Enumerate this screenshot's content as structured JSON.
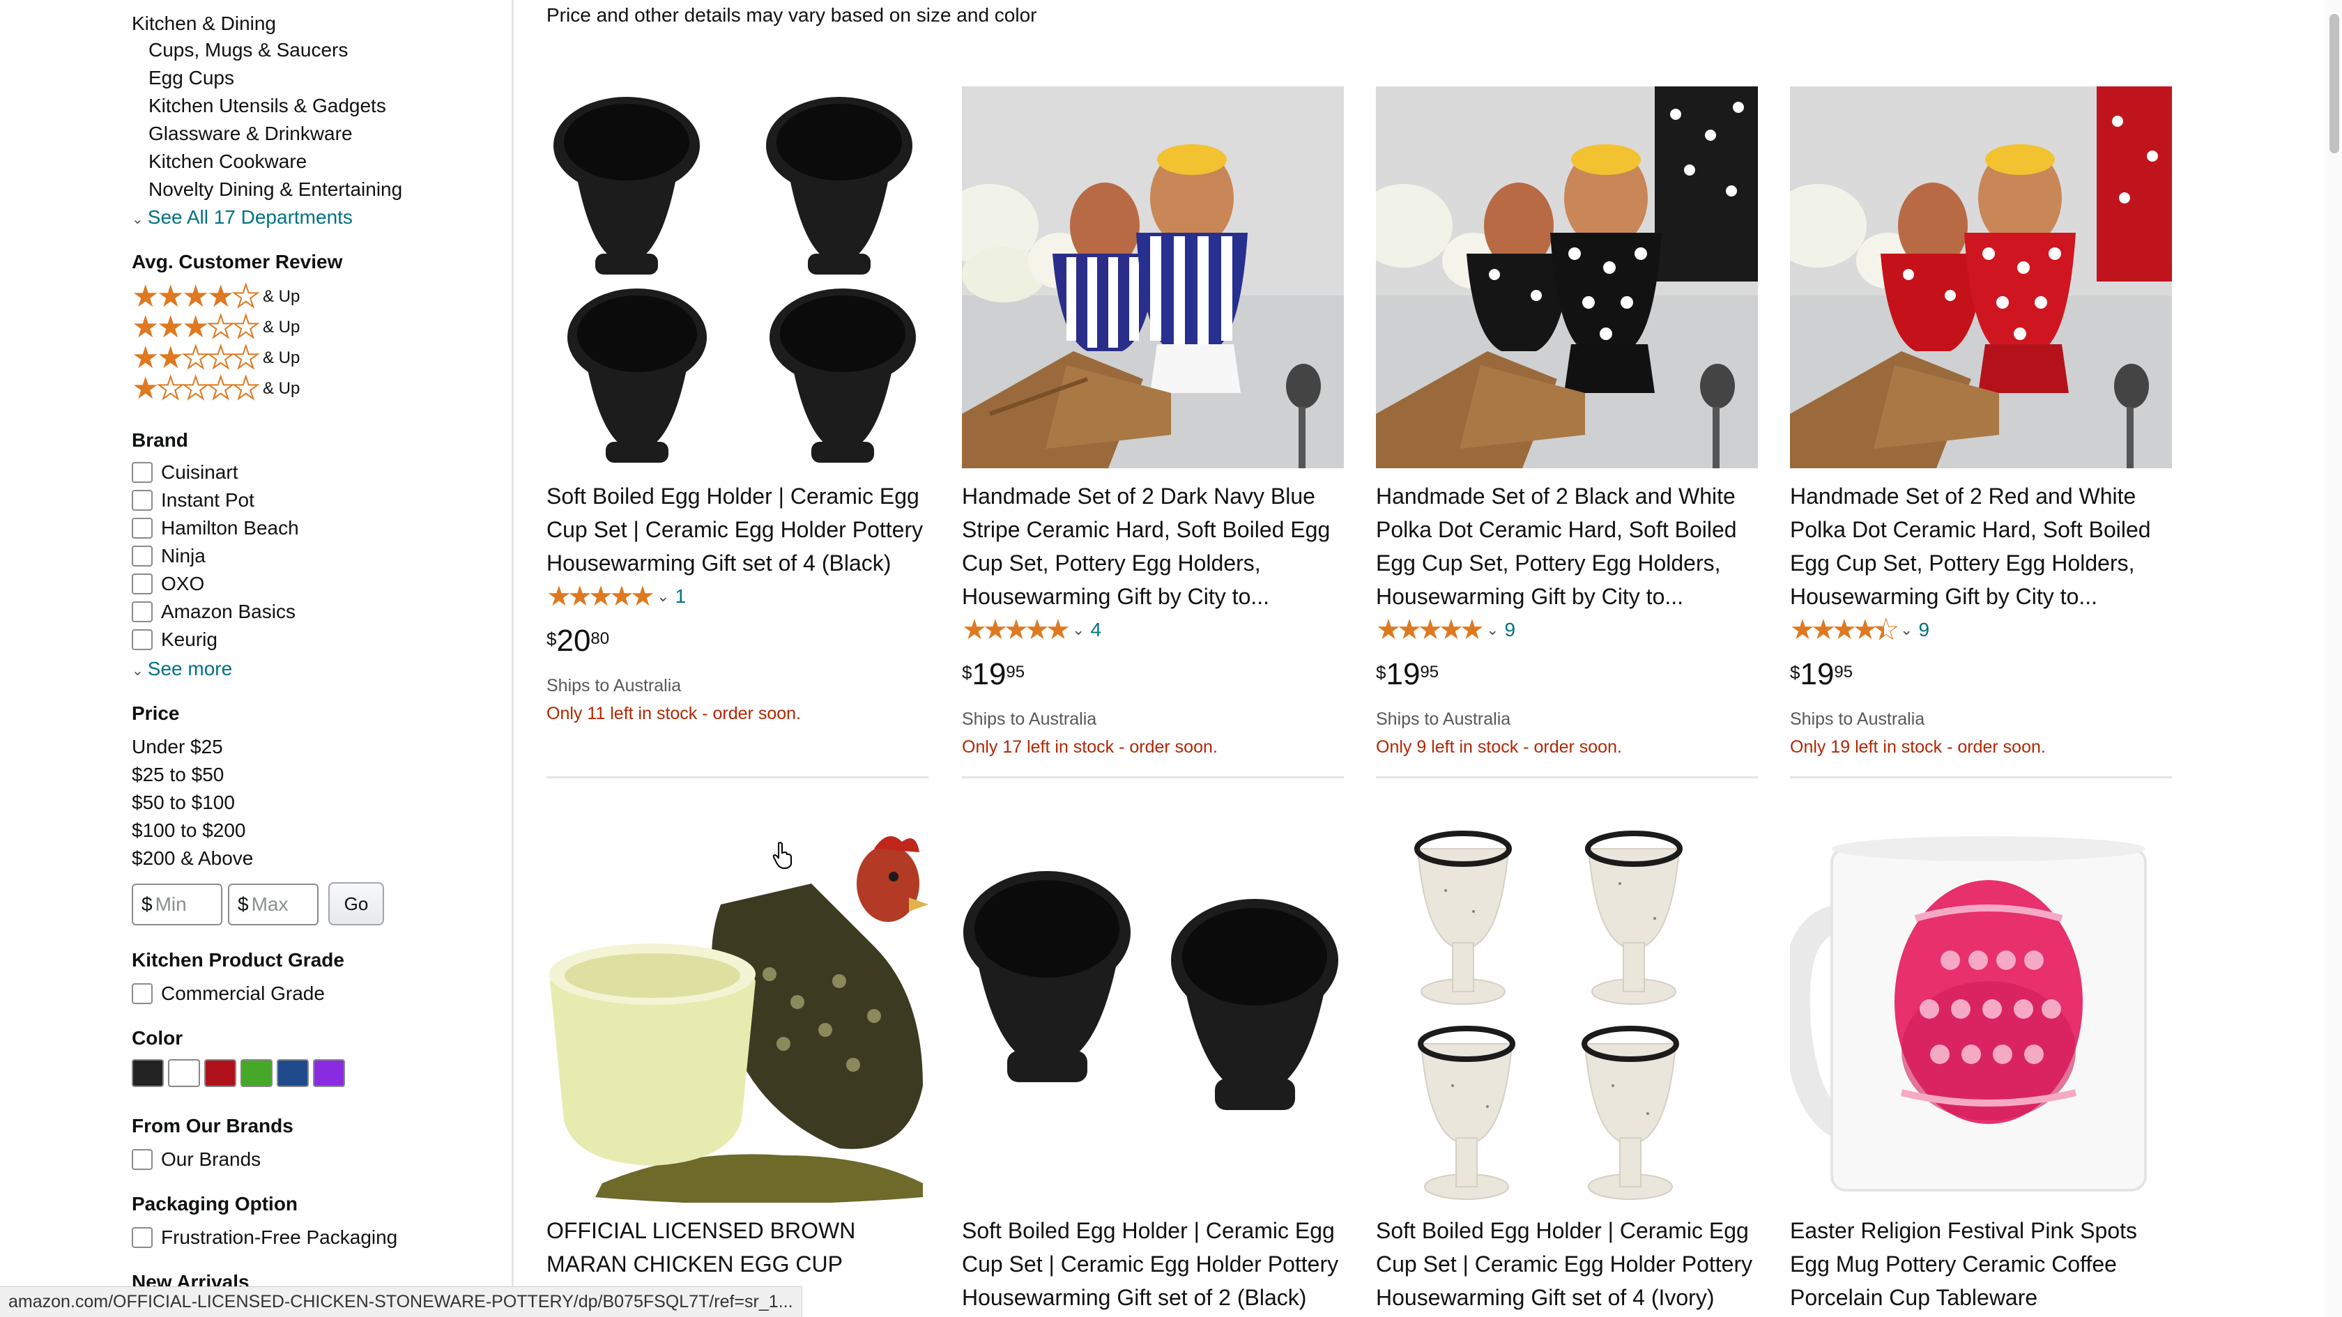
{
  "sidebar": {
    "department": "Kitchen & Dining",
    "subcategories": [
      "Cups, Mugs & Saucers",
      "Egg Cups",
      "Kitchen Utensils & Gadgets",
      "Glassware & Drinkware",
      "Kitchen Cookware",
      "Novelty Dining & Entertaining"
    ],
    "see_all": "See All 17 Departments",
    "review_heading": "Avg. Customer Review",
    "review_rows": [
      {
        "stars": 4,
        "label": "& Up"
      },
      {
        "stars": 3,
        "label": "& Up"
      },
      {
        "stars": 2,
        "label": "& Up"
      },
      {
        "stars": 1,
        "label": "& Up"
      }
    ],
    "brand_heading": "Brand",
    "brands": [
      "Cuisinart",
      "Instant Pot",
      "Hamilton Beach",
      "Ninja",
      "OXO",
      "Amazon Basics",
      "Keurig"
    ],
    "see_more": "See more",
    "price_heading": "Price",
    "price_ranges": [
      "Under $25",
      "$25 to $50",
      "$50 to $100",
      "$100 to $200",
      "$200 & Above"
    ],
    "min_symbol": "$",
    "min_placeholder": "Min",
    "max_symbol": "$",
    "max_placeholder": "Max",
    "go_label": "Go",
    "grade_heading": "Kitchen Product Grade",
    "grade_option": "Commercial Grade",
    "color_heading": "Color",
    "colors": [
      "#232323",
      "#ffffff",
      "#b0121b",
      "#46a829",
      "#1f4b8c",
      "#8a2be2"
    ],
    "our_brands_heading": "From Our Brands",
    "our_brands_option": "Our Brands",
    "packaging_heading": "Packaging Option",
    "packaging_option": "Frustration-Free Packaging",
    "new_arrivals_heading": "New Arrivals"
  },
  "main": {
    "notice": "Price and other details may vary based on size and color",
    "products": [
      {
        "title": "Soft Boiled Egg Holder | Ceramic Egg Cup Set | Ceramic Egg Holder Pottery Housewarming Gift set of 4 (Black)",
        "rating": 5,
        "reviews": "1",
        "price_symbol": "$",
        "price_whole": "20",
        "price_fraction": "80",
        "ships": "Ships to Australia",
        "stock": "Only 11 left in stock - order soon.",
        "image": "black-egg-cups-4"
      },
      {
        "title": "Handmade Set of 2 Dark Navy Blue Stripe Ceramic Hard, Soft Boiled Egg Cup Set, Pottery Egg Holders, Housewarming Gift by City to...",
        "rating": 5,
        "reviews": "4",
        "price_symbol": "$",
        "price_whole": "19",
        "price_fraction": "95",
        "ships": "Ships to Australia",
        "stock": "Only 17 left in stock - order soon.",
        "image": "blue-stripe-egg-cups"
      },
      {
        "title": "Handmade Set of 2 Black and White Polka Dot Ceramic Hard, Soft Boiled Egg Cup Set, Pottery Egg Holders, Housewarming Gift by City to...",
        "rating": 5,
        "reviews": "9",
        "price_symbol": "$",
        "price_whole": "19",
        "price_fraction": "95",
        "ships": "Ships to Australia",
        "stock": "Only 9 left in stock - order soon.",
        "image": "black-polka-egg-cups"
      },
      {
        "title": "Handmade Set of 2 Red and White Polka Dot Ceramic Hard, Soft Boiled Egg Cup Set, Pottery Egg Holders, Housewarming Gift by City to...",
        "rating": 4.5,
        "reviews": "9",
        "price_symbol": "$",
        "price_whole": "19",
        "price_fraction": "95",
        "ships": "Ships to Australia",
        "stock": "Only 19 left in stock - order soon.",
        "image": "red-polka-egg-cups"
      },
      {
        "title": "OFFICIAL LICENSED BROWN MARAN CHICKEN EGG CUP STONEWARE",
        "image": "chicken-egg-cup"
      },
      {
        "title": "Soft Boiled Egg Holder | Ceramic Egg Cup Set | Ceramic Egg Holder Pottery Housewarming Gift set of 2 (Black)",
        "image": "black-egg-cups-2"
      },
      {
        "title": "Soft Boiled Egg Holder | Ceramic Egg Cup Set | Ceramic Egg Holder Pottery Housewarming Gift set of 4 (Ivory)",
        "image": "ivory-egg-cups-4"
      },
      {
        "title": "Easter Religion Festival Pink Spots Egg Mug Pottery Ceramic Coffee Porcelain Cup Tableware",
        "image": "easter-egg-mug"
      }
    ]
  },
  "status_url": "amazon.com/OFFICIAL-LICENSED-CHICKEN-STONEWARE-POTTERY/dp/B075FSQL7T/ref=sr_1..."
}
